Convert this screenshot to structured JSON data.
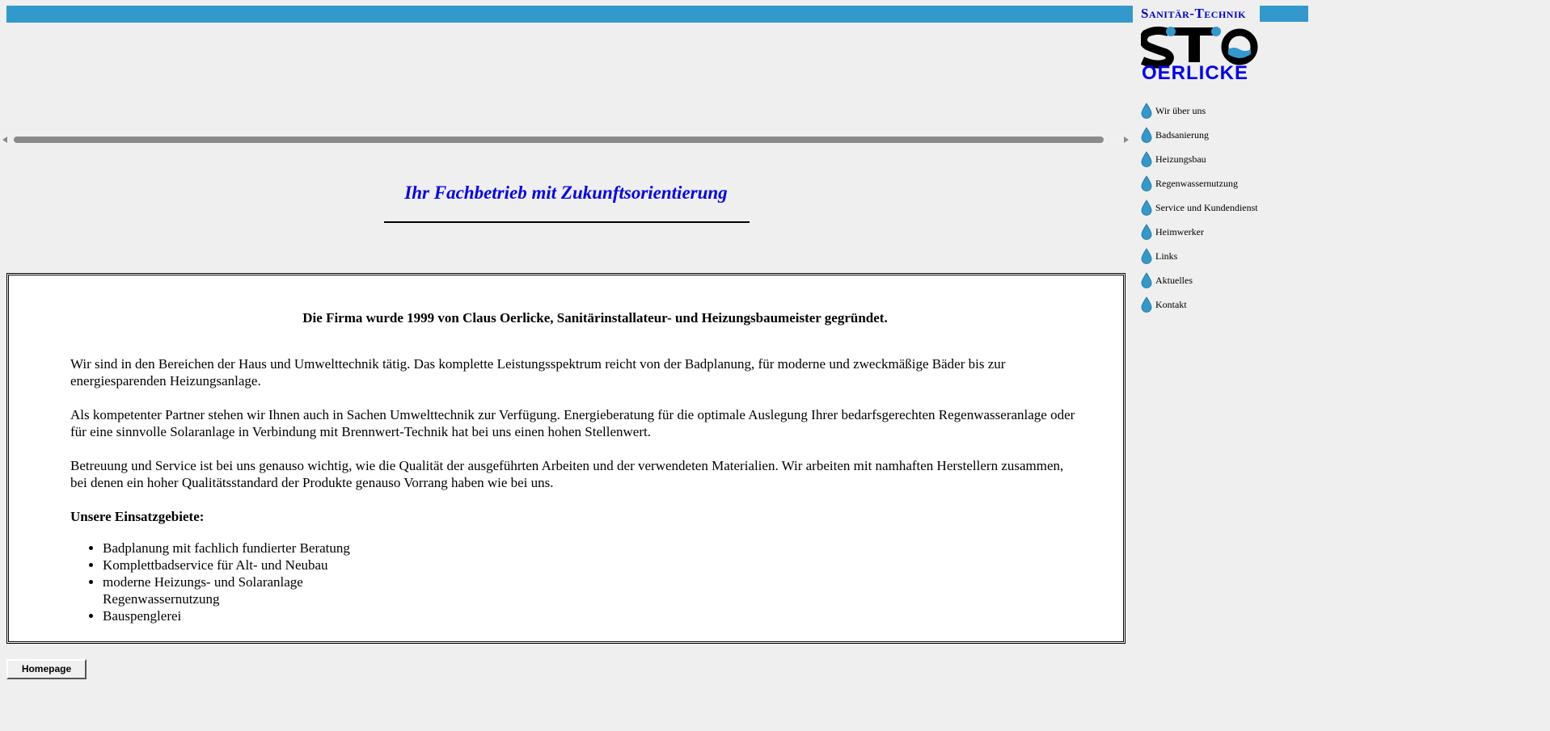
{
  "header": {
    "headline": "Ihr Fachbetrieb mit Zukunftsorientierung"
  },
  "logo": {
    "top_text": "Sanitär-Technik",
    "mark_text": "STO",
    "bottom_text": "OERLICKE",
    "colors": {
      "blue": "#0000ee",
      "water": "#3399cc"
    }
  },
  "nav": {
    "items": [
      {
        "label": "Wir über uns"
      },
      {
        "label": "Badsanierung"
      },
      {
        "label": "Heizungsbau"
      },
      {
        "label": "Regenwassernutzung"
      },
      {
        "label": "Service und Kundendienst"
      },
      {
        "label": "Heimwerker"
      },
      {
        "label": "Links"
      },
      {
        "label": "Aktuelles"
      },
      {
        "label": "Kontakt"
      }
    ],
    "icon": "water-drop-icon"
  },
  "content": {
    "lead": "Die Firma wurde 1999 von Claus Oerlicke, Sanitärinstallateur- und Heizungsbaumeister gegründet.",
    "paragraphs": [
      "Wir sind in den Bereichen der Haus und Umwelttechnik tätig. Das komplette Leistungsspektrum reicht von der Badplanung, für moderne und zweckmäßige Bäder bis zur energiesparenden Heizungsanlage.",
      "Als kompetenter Partner stehen wir Ihnen auch in Sachen Umwelttechnik zur Verfügung. Energieberatung für die optimale Auslegung Ihrer bedarfsgerechten Regenwasseranlage oder für eine sinnvolle Solaranlage in Verbindung mit Brennwert-Technik hat bei uns einen hohen Stellenwert.",
      "Betreuung und Service ist bei uns genauso wichtig, wie die Qualität der ausgeführten Arbeiten und der verwendeten Materialien. Wir arbeiten mit namhaften Herstellern zusammen, bei denen ein hoher Qualitätsstandard der Produkte genauso Vorrang haben wie bei uns."
    ],
    "subheading": "Unsere Einsatzgebiete:",
    "list": [
      "Badplanung mit fachlich fundierter Beratung",
      "Komplettbadservice für Alt- und Neubau",
      "moderne Heizungs- und Solaranlage",
      "Regenwassernutzung",
      "Bauspenglerei"
    ]
  },
  "footer": {
    "home_button": "Homepage"
  }
}
